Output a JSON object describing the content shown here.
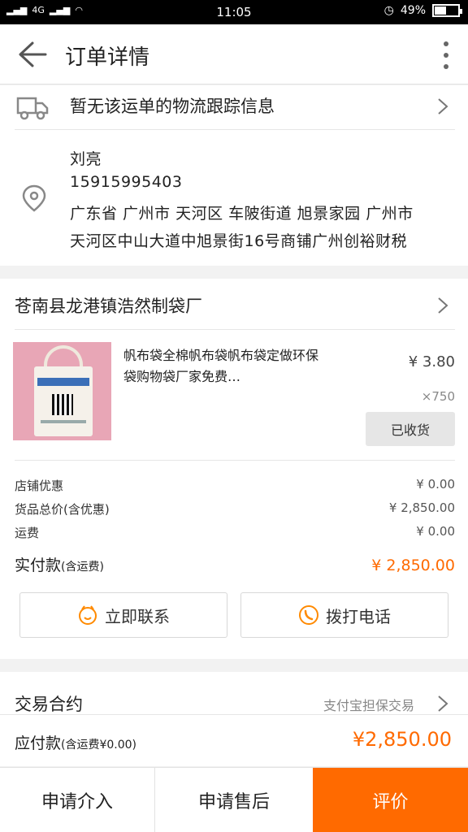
{
  "status_bar": {
    "network": "4G",
    "time": "11:05",
    "battery": "49%",
    "battery_level": 0.49
  },
  "header": {
    "title": "订单详情"
  },
  "logistics": {
    "text": "暂无该运单的物流跟踪信息"
  },
  "address": {
    "name": "刘亮",
    "phone": "15915995403",
    "line1": "广东省 广州市 天河区 车陂街道 旭景家园 广州市",
    "line2": "天河区中山大道中旭景街16号商铺广州创裕财税"
  },
  "shop": {
    "name": "苍南县龙港镇浩然制袋厂"
  },
  "product": {
    "title": "帆布袋全棉帆布袋帆布袋定做环保袋购物袋厂家免费…",
    "price": "¥ 3.80",
    "quantity": "×750",
    "status_button": "已收货"
  },
  "fees": {
    "shop_discount_label": "店铺优惠",
    "shop_discount_value": "¥ 0.00",
    "goods_total_label": "货品总价(含优惠)",
    "goods_total_value": "¥ 2,850.00",
    "shipping_label": "运费",
    "shipping_value": "¥ 0.00",
    "actual_paid_label": "实付款",
    "actual_paid_note": "(含运费)",
    "actual_paid_value": "¥ 2,850.00"
  },
  "actions": {
    "contact_label": "立即联系",
    "call_label": "拨打电话"
  },
  "contract": {
    "label": "交易合约",
    "value": "支付宝担保交易"
  },
  "payable": {
    "label": "应付款",
    "note": "(含运费¥0.00)",
    "value": "¥2,850.00"
  },
  "bottom_bar": {
    "intervene_label": "申请介入",
    "aftersale_label": "申请售后",
    "review_label": "评价"
  },
  "colors": {
    "accent": "#ff6a00",
    "background": "#f2f2f2"
  }
}
